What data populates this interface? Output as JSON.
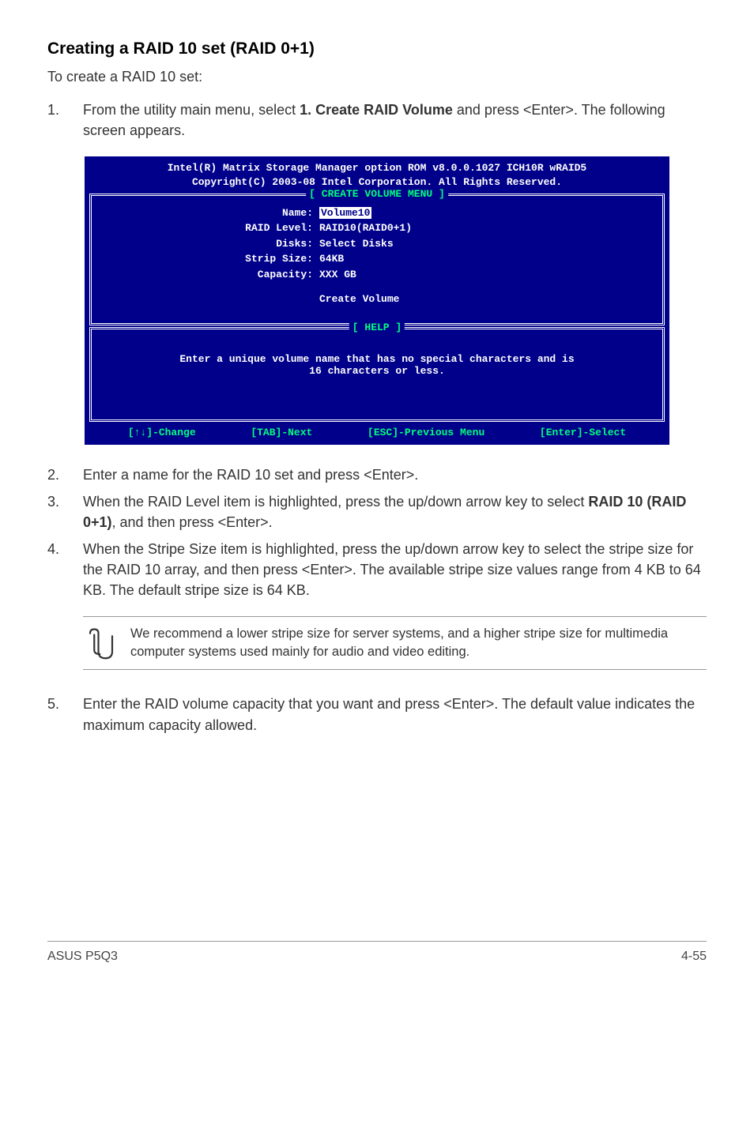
{
  "heading": "Creating a RAID 10 set (RAID 0+1)",
  "intro": "To create a RAID 10 set:",
  "step1": {
    "num": "1.",
    "text_a": "From the utility main menu, select ",
    "bold": "1. Create RAID Volume",
    "text_b": " and press <Enter>. The following screen appears."
  },
  "terminal": {
    "header_line1": "Intel(R) Matrix Storage Manager option ROM v8.0.0.1027 ICH10R wRAID5",
    "header_line2": "Copyright(C) 2003-08 Intel Corporation. All Rights Reserved.",
    "menu_label": "[ CREATE VOLUME MENU ]",
    "rows": {
      "name_label": "Name:",
      "name_value": "Volume10",
      "raid_label": "RAID Level:",
      "raid_value": "RAID10(RAID0+1)",
      "disks_label": "Disks:",
      "disks_value": "Select Disks",
      "strip_label": "Strip Size:",
      "strip_value": "64KB",
      "capacity_label": "Capacity:",
      "capacity_value": "XXX   GB"
    },
    "create_label": "Create Volume",
    "help_label": "[ HELP ]",
    "help_text1": "Enter a unique volume name that has no special characters and is",
    "help_text2": "16 characters or less.",
    "footer": {
      "change": "[↑↓]-Change",
      "next": "[TAB]-Next",
      "prev": "[ESC]-Previous Menu",
      "select": "[Enter]-Select"
    }
  },
  "step2": {
    "num": "2.",
    "text": "Enter a name for the RAID 10 set and press <Enter>."
  },
  "step3": {
    "num": "3.",
    "text_a": "When the RAID Level item is highlighted, press the up/down arrow key to select ",
    "bold": "RAID 10 (RAID 0+1)",
    "text_b": ", and then press <Enter>."
  },
  "step4": {
    "num": "4.",
    "text": "When the Stripe Size item is highlighted, press the up/down arrow key to select the stripe size for the RAID 10 array, and then press <Enter>. The available stripe size values range from 4 KB to 64 KB. The default stripe size is 64 KB."
  },
  "note": "We recommend a lower stripe size for server systems, and a higher stripe size for multimedia computer systems used mainly for audio and video editing.",
  "step5": {
    "num": "5.",
    "text": "Enter the RAID volume capacity that you want and press <Enter>. The default value indicates the maximum capacity allowed."
  },
  "footer_left": "ASUS P5Q3",
  "footer_right": "4-55"
}
